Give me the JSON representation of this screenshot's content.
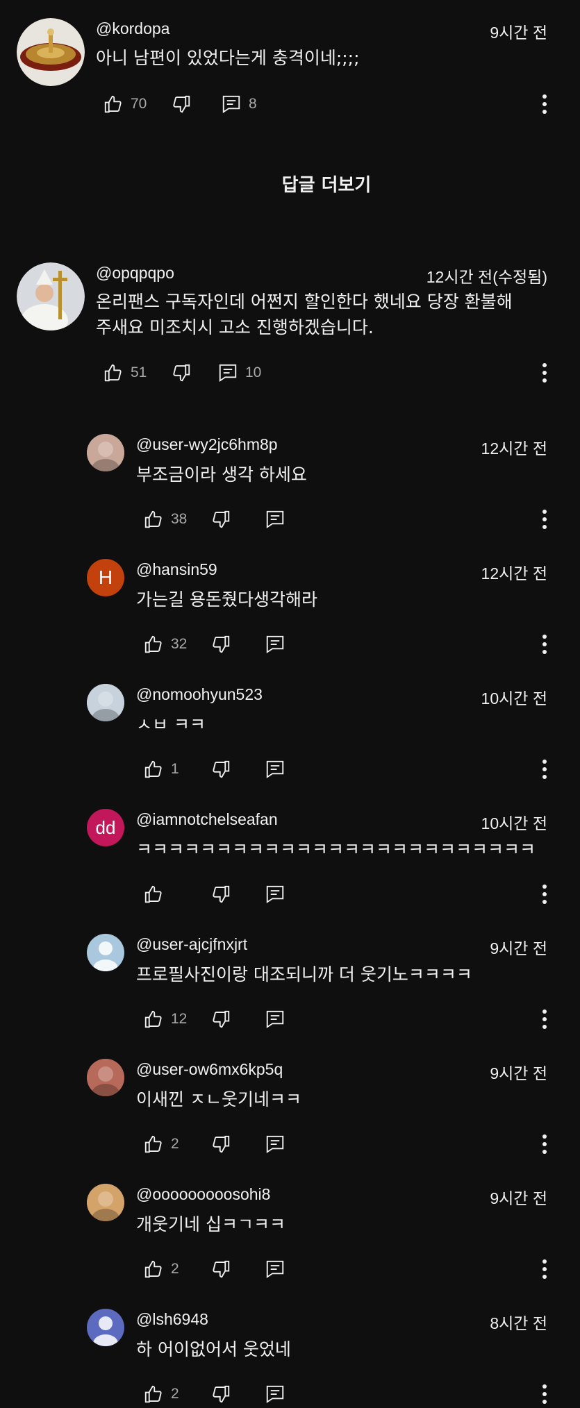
{
  "load_more_label": "답글 더보기",
  "comments": [
    {
      "handle": "@kordopa",
      "time": "9시간 전",
      "text": "아니 남편이 있었다는게 충격이네;;;;",
      "likes": "70",
      "replies": "8"
    },
    {
      "handle": "@opqpqpo",
      "time": "12시간 전(수정됨)",
      "text": "온리팬스 구독자인데 어쩐지 할인한다 했네요 당장 환불해\n주새요 미조치시 고소 진행하겠습니다.",
      "likes": "51",
      "replies": "10"
    }
  ],
  "replies": [
    {
      "handle": "@user-wy2jc6hm8p",
      "time": "12시간 전",
      "text": "부조금이라 생각 하세요",
      "likes": "38",
      "avatar": {
        "type": "photo",
        "color": "#c9a89a"
      }
    },
    {
      "handle": "@hansin59",
      "time": "12시간 전",
      "text": "가는길 용돈줬다생각해라",
      "likes": "32",
      "avatar": {
        "type": "letter",
        "letter": "H",
        "color": "#c2410c"
      }
    },
    {
      "handle": "@nomoohyun523",
      "time": "10시간 전",
      "text": "ㅅㅂ ㅋㅋ",
      "likes": "1",
      "avatar": {
        "type": "photo",
        "color": "#c7d2dc"
      }
    },
    {
      "handle": "@iamnotchelseafan",
      "time": "10시간 전",
      "text": "ㅋㅋㅋㅋㅋㅋㅋㅋㅋㅋㅋㅋㅋㅋㅋㅋㅋㅋㅋㅋㅋㅋㅋㅋㅋ",
      "likes": "",
      "avatar": {
        "type": "letter",
        "letter": "dd",
        "color": "#c2185b"
      }
    },
    {
      "handle": "@user-ajcjfnxjrt",
      "time": "9시간 전",
      "text": "프로필사진이랑 대조되니까 더 웃기노ㅋㅋㅋㅋ",
      "likes": "12",
      "avatar": {
        "type": "default",
        "color": "#a9c7dd"
      }
    },
    {
      "handle": "@user-ow6mx6kp5q",
      "time": "9시간 전",
      "text": "이새낀 ㅈㄴ웃기네ㅋㅋ",
      "likes": "2",
      "avatar": {
        "type": "photo",
        "color": "#b86a5a"
      }
    },
    {
      "handle": "@ooooooooosohi8",
      "time": "9시간 전",
      "text": "개웃기네 십ㅋㄱㅋㅋ",
      "likes": "2",
      "avatar": {
        "type": "photo",
        "color": "#d4a36a"
      }
    },
    {
      "handle": "@lsh6948",
      "time": "8시간 전",
      "text": "하 어이없어서 웃었네",
      "likes": "2",
      "avatar": {
        "type": "default",
        "color": "#5c6bc0"
      }
    }
  ],
  "icons": {
    "like": "thumb-up-icon",
    "dislike": "thumb-down-icon",
    "reply": "comment-icon",
    "more": "more-vert-icon"
  }
}
